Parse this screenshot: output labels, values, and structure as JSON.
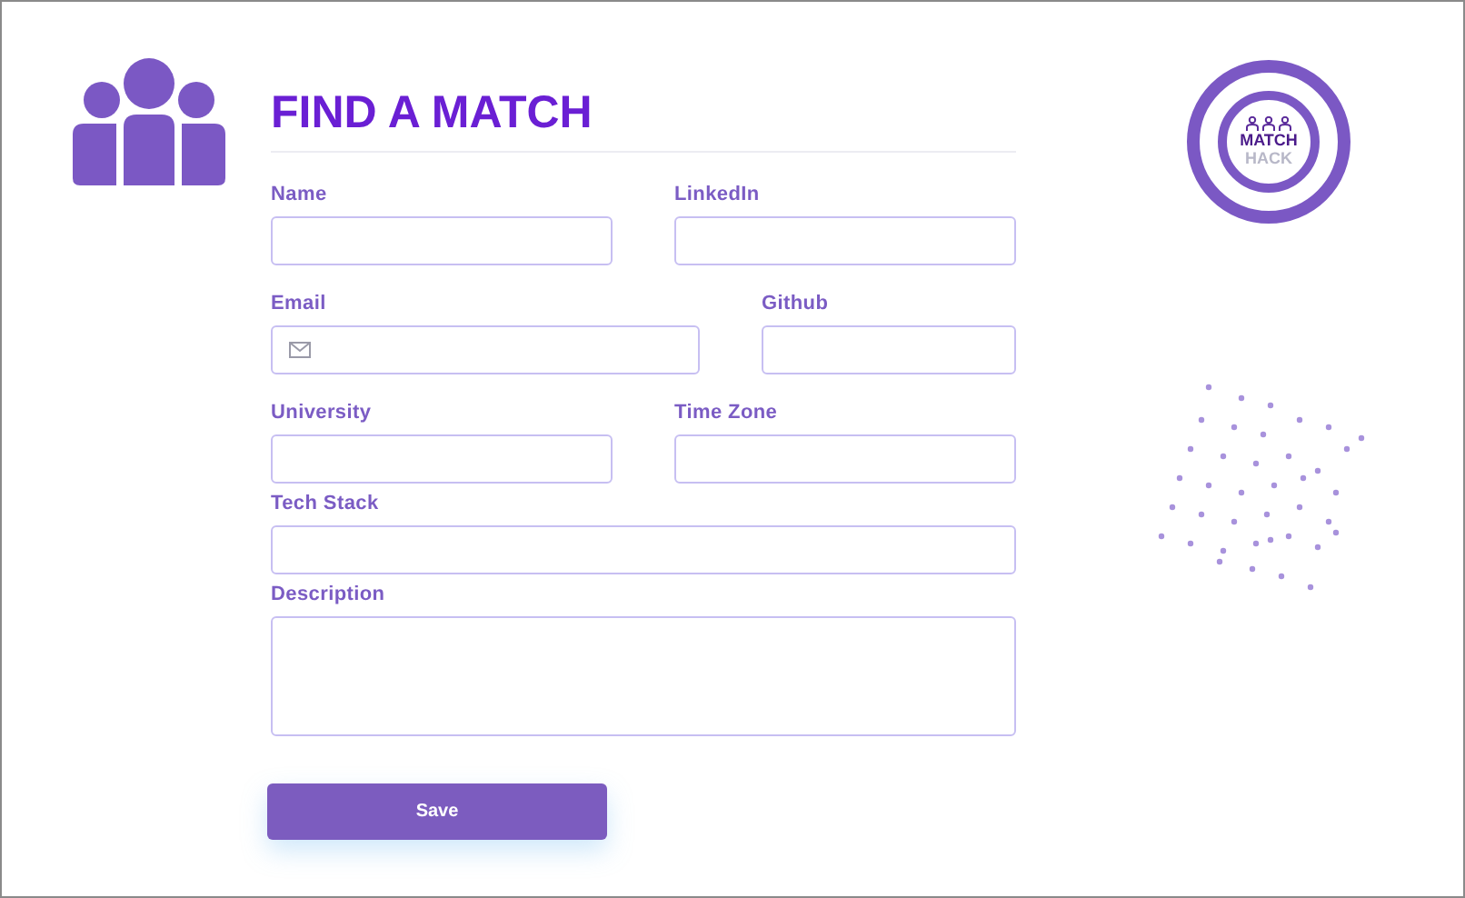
{
  "title": "FIND A MATCH",
  "logo": {
    "line_1": "MATCH",
    "line_2": "HACK"
  },
  "form_rows": [
    [
      {
        "label": "Name",
        "kind": "text"
      },
      {
        "label": "LinkedIn",
        "kind": "text"
      }
    ],
    [
      {
        "label": "Email",
        "kind": "email"
      },
      {
        "label": "Github",
        "kind": "text"
      }
    ],
    [
      {
        "label": "University",
        "kind": "text"
      },
      {
        "label": "Time Zone",
        "kind": "text"
      }
    ],
    [
      {
        "label": "Tech Stack",
        "kind": "text"
      }
    ],
    [
      {
        "label": "Description",
        "kind": "textarea"
      }
    ]
  ],
  "buttons": [
    {
      "label": "Save"
    }
  ]
}
